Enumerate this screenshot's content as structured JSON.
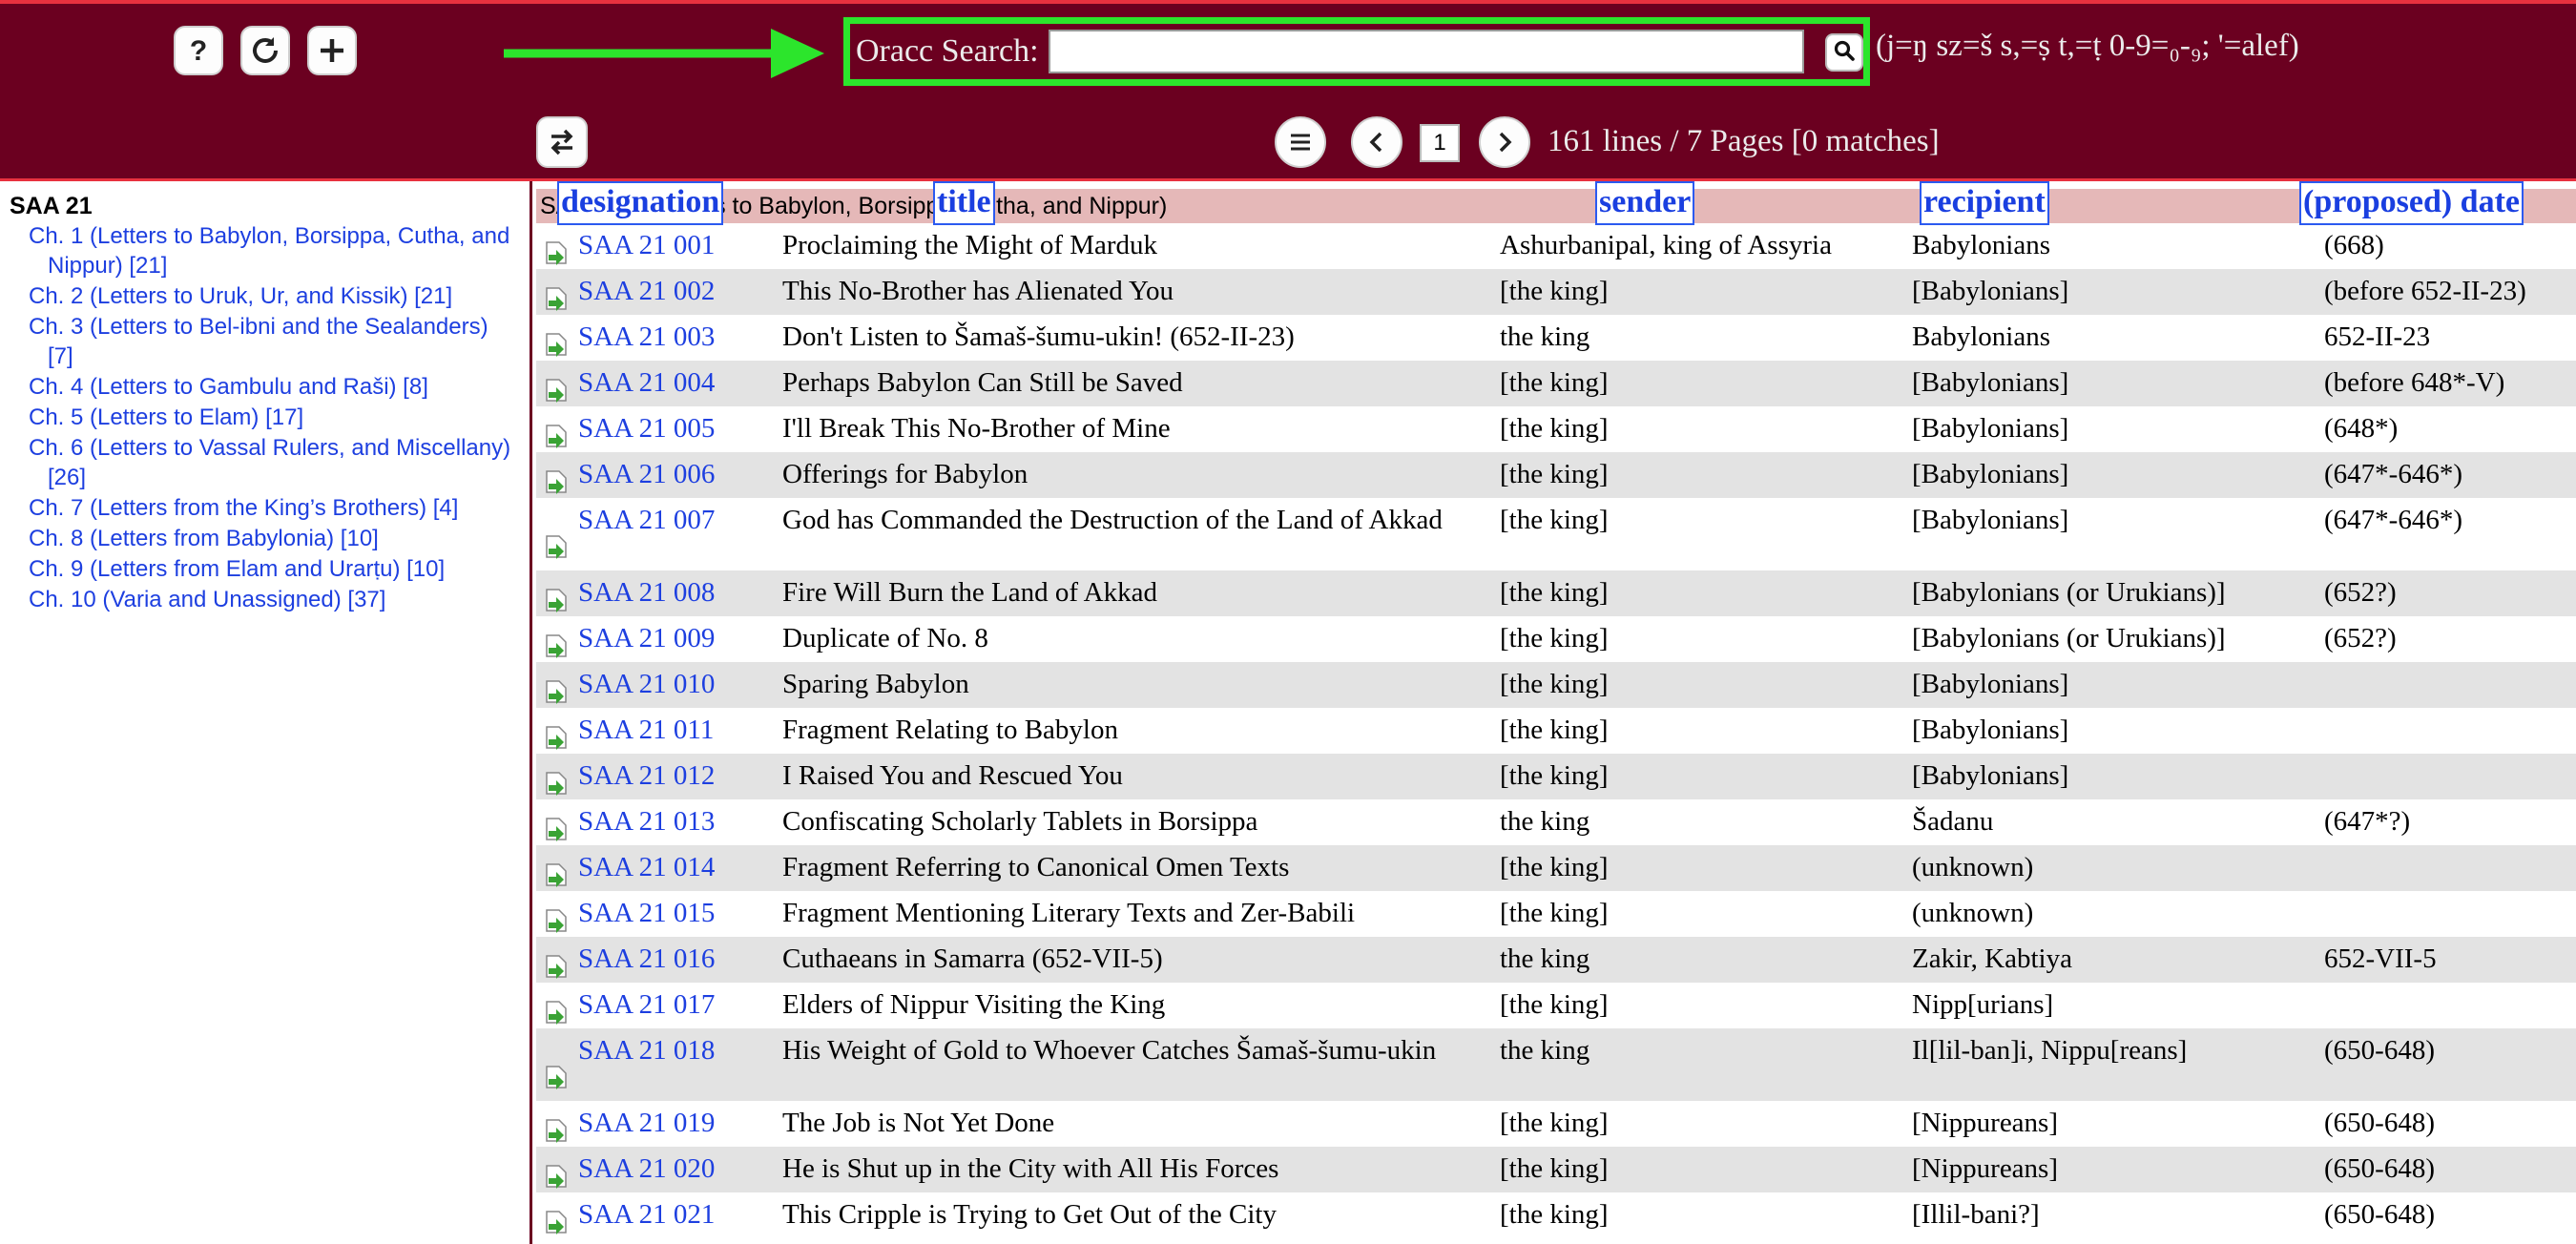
{
  "header": {
    "search_label": "Oracc Search:",
    "search_value": "",
    "translit_hint": "(j=ŋ sz=š s,=ṣ t,=ṭ 0-9=₀-₉; '=alef)",
    "page_number": "1",
    "page_info": "161 lines / 7 Pages [0 matches]",
    "icons": {
      "help": "question-icon",
      "reload": "reload-icon",
      "add": "plus-icon",
      "search": "magnifier-icon",
      "toggle": "swap-arrows-icon",
      "menu": "list-icon",
      "prev": "chevron-left-icon",
      "next": "chevron-right-icon"
    },
    "highlight_color": "#2ce52c",
    "bar_color": "#6b0020"
  },
  "sidebar": {
    "title": "SAA 21",
    "chapters": [
      "Ch. 1 (Letters to Babylon, Borsippa, Cutha, and Nippur) [21]",
      "Ch. 2 (Letters to Uruk, Ur, and Kissik) [21]",
      "Ch. 3 (Letters to Bel-ibni and the Sealanders) [7]",
      "Ch. 4 (Letters to Gambulu and Raši) [8]",
      "Ch. 5 (Letters to Elam) [17]",
      "Ch. 6 (Letters to Vassal Rulers, and Miscellany) [26]",
      "Ch. 7 (Letters from the King’s Brothers) [4]",
      "Ch. 8 (Letters from Babylonia) [10]",
      "Ch. 9 (Letters from Elam and Urarṭu) [10]",
      "Ch. 10 (Varia and Unassigned) [37]"
    ]
  },
  "table": {
    "group_header": "SAA 21 1. Letters to Babylon, Borsippa, Cutha, and Nippur)",
    "columns": {
      "designation": "designation",
      "title": "title",
      "sender": "sender",
      "recipient": "recipient",
      "date": "(proposed) date"
    },
    "rows": [
      {
        "designation": "SAA 21 001",
        "title": "Proclaiming the Might of Marduk",
        "sender": "Ashurbanipal, king of Assyria",
        "recipient": "Babylonians",
        "date": "(668)"
      },
      {
        "designation": "SAA 21 002",
        "title": "This No-Brother has Alienated You",
        "sender": "[the king]",
        "recipient": "[Babylonians]",
        "date": "(before 652-II-23)"
      },
      {
        "designation": "SAA 21 003",
        "title": "Don't Listen to Šamaš-šumu-ukin! (652-II-23)",
        "sender": "the king",
        "recipient": "Babylonians",
        "date": "652-II-23"
      },
      {
        "designation": "SAA 21 004",
        "title": "Perhaps Babylon Can Still be Saved",
        "sender": "[the king]",
        "recipient": "[Babylonians]",
        "date": "(before 648*-V)"
      },
      {
        "designation": "SAA 21 005",
        "title": "I'll Break This No-Brother of Mine",
        "sender": "[the king]",
        "recipient": "[Babylonians]",
        "date": "(648*)"
      },
      {
        "designation": "SAA 21 006",
        "title": "Offerings for Babylon",
        "sender": "[the king]",
        "recipient": "[Babylonians]",
        "date": "(647*-646*)"
      },
      {
        "designation": "SAA 21 007",
        "title": "God has Commanded the Destruction of the Land of Akkad",
        "sender": "[the king]",
        "recipient": "[Babylonians]",
        "date": "(647*-646*)"
      },
      {
        "designation": "SAA 21 008",
        "title": "Fire Will Burn the Land of Akkad",
        "sender": "[the king]",
        "recipient": "[Babylonians (or Urukians)]",
        "date": "(652?)"
      },
      {
        "designation": "SAA 21 009",
        "title": "Duplicate of No. 8",
        "sender": "[the king]",
        "recipient": "[Babylonians (or Urukians)]",
        "date": "(652?)"
      },
      {
        "designation": "SAA 21 010",
        "title": "Sparing Babylon",
        "sender": "[the king]",
        "recipient": "[Babylonians]",
        "date": ""
      },
      {
        "designation": "SAA 21 011",
        "title": "Fragment Relating to Babylon",
        "sender": "[the king]",
        "recipient": "[Babylonians]",
        "date": ""
      },
      {
        "designation": "SAA 21 012",
        "title": "I Raised You and Rescued You",
        "sender": "[the king]",
        "recipient": "[Babylonians]",
        "date": ""
      },
      {
        "designation": "SAA 21 013",
        "title": "Confiscating Scholarly Tablets in Borsippa",
        "sender": "the king",
        "recipient": "Šadanu",
        "date": "(647*?)"
      },
      {
        "designation": "SAA 21 014",
        "title": "Fragment Referring to Canonical Omen Texts",
        "sender": "[the king]",
        "recipient": "(unknown)",
        "date": ""
      },
      {
        "designation": "SAA 21 015",
        "title": "Fragment Mentioning Literary Texts and Zer-Babili",
        "sender": "[the king]",
        "recipient": "(unknown)",
        "date": ""
      },
      {
        "designation": "SAA 21 016",
        "title": "Cuthaeans in Samarra (652-VII-5)",
        "sender": "the king",
        "recipient": "Zakir, Kabtiya",
        "date": "652-VII-5"
      },
      {
        "designation": "SAA 21 017",
        "title": "Elders of Nippur Visiting the King",
        "sender": "[the king]",
        "recipient": "Nipp[urians]",
        "date": ""
      },
      {
        "designation": "SAA 21 018",
        "title": "His Weight of Gold to Whoever Catches Šamaš-šumu-ukin",
        "sender": "the king",
        "recipient": "Il[lil-ban]i, Nippu[reans]",
        "date": "(650-648)"
      },
      {
        "designation": "SAA 21 019",
        "title": "The Job is Not Yet Done",
        "sender": "[the king]",
        "recipient": "[Nippureans]",
        "date": "(650-648)"
      },
      {
        "designation": "SAA 21 020",
        "title": "He is Shut up in the City with All His Forces",
        "sender": "[the king]",
        "recipient": "[Nippureans]",
        "date": "(650-648)"
      },
      {
        "designation": "SAA 21 021",
        "title": "This Cripple is Trying to Get Out of the City",
        "sender": "[the king]",
        "recipient": "[Illil-bani?]",
        "date": "(650-648)"
      }
    ]
  }
}
